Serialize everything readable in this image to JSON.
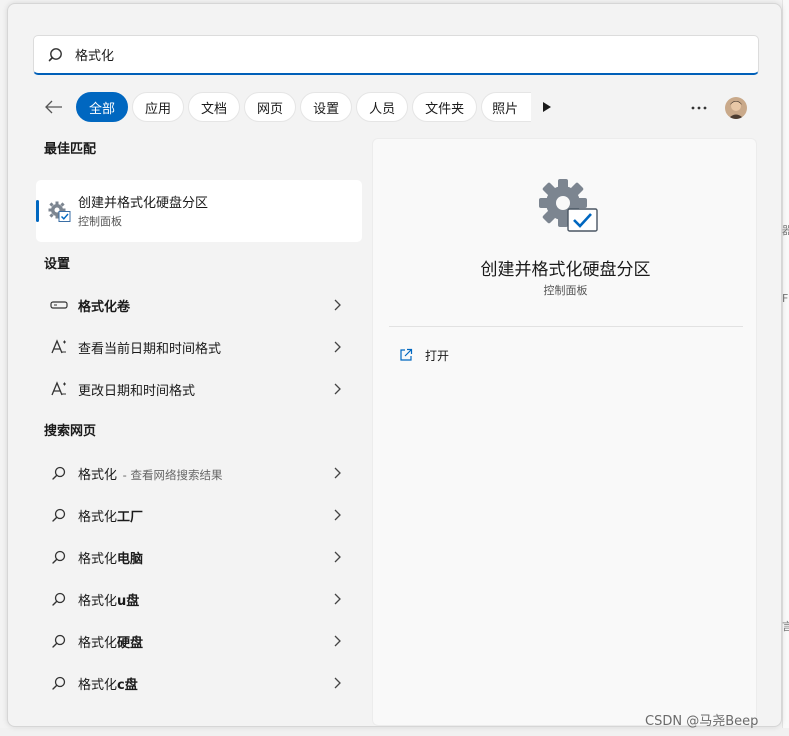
{
  "search": {
    "value": "格式化",
    "placeholder": ""
  },
  "tabs": [
    {
      "label": "全部",
      "active": true
    },
    {
      "label": "应用"
    },
    {
      "label": "文档"
    },
    {
      "label": "网页"
    },
    {
      "label": "设置"
    },
    {
      "label": "人员"
    },
    {
      "label": "文件夹"
    },
    {
      "label": "照片"
    }
  ],
  "sections": {
    "best_match": "最佳匹配",
    "settings": "设置",
    "web": "搜索网页"
  },
  "best_match": {
    "title": "创建并格式化硬盘分区",
    "subtitle": "控制面板"
  },
  "settings_items": [
    {
      "label": "格式化卷",
      "icon": "drive-icon"
    },
    {
      "label": "查看当前日期和时间格式",
      "icon": "font-a-icon"
    },
    {
      "label": "更改日期和时间格式",
      "icon": "font-a-icon"
    }
  ],
  "web_items": [
    {
      "prefix": "格式化",
      "bold": "",
      "suffix": " - 查看网络搜索结果"
    },
    {
      "prefix": "格式化",
      "bold": "工厂",
      "suffix": ""
    },
    {
      "prefix": "格式化",
      "bold": "电脑",
      "suffix": ""
    },
    {
      "prefix": "格式化",
      "bold": "u盘",
      "suffix": ""
    },
    {
      "prefix": "格式化",
      "bold": "硬盘",
      "suffix": ""
    },
    {
      "prefix": "格式化",
      "bold": "c盘",
      "suffix": ""
    }
  ],
  "preview": {
    "title": "创建并格式化硬盘分区",
    "subtitle": "控制面板",
    "open_label": "打开"
  },
  "watermark": "CSDN @马尧Beep",
  "colors": {
    "accent": "#0067c0",
    "focus_underline": "#005fb8"
  }
}
